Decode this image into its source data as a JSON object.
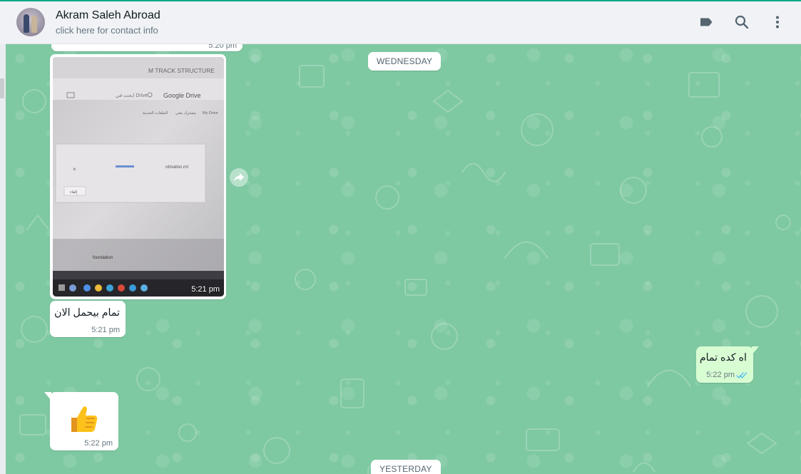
{
  "header": {
    "contact_name": "Akram Saleh Abroad",
    "contact_subtitle": "click here for contact info",
    "icons": [
      "label-icon",
      "search-icon",
      "menu-icon"
    ]
  },
  "chat": {
    "date_dividers": {
      "wednesday": "WEDNESDAY",
      "yesterday": "YESTERDAY"
    },
    "top_partial_time": "5:20 pm",
    "photo_message": {
      "time": "5:21 pm",
      "photo_texts": {
        "title": "M TRACK STRUCTURE",
        "search": "ابحث في Drive",
        "drive": "Google Drive",
        "my_drive": "My Drive",
        "shared": "مشترك معي",
        "recent": "الملفات الحديثة",
        "file": "rdmation.rnt",
        "cancel": "إلغاء",
        "foundation": "foundation"
      }
    },
    "messages": [
      {
        "direction": "incoming",
        "text": "تمام بيحمل الان",
        "time": "5:21 pm"
      },
      {
        "direction": "outgoing",
        "text": "اه كده تمام",
        "time": "5:22 pm",
        "status": "read"
      },
      {
        "direction": "incoming",
        "emoji": "thumbs-up",
        "time": "5:22 pm"
      }
    ]
  },
  "colors": {
    "wallpaper": "#7ec8a2",
    "incoming_bubble": "#ffffff",
    "outgoing_bubble": "#d9fdd3",
    "read_ticks": "#53bdeb",
    "accent": "#00a884"
  }
}
